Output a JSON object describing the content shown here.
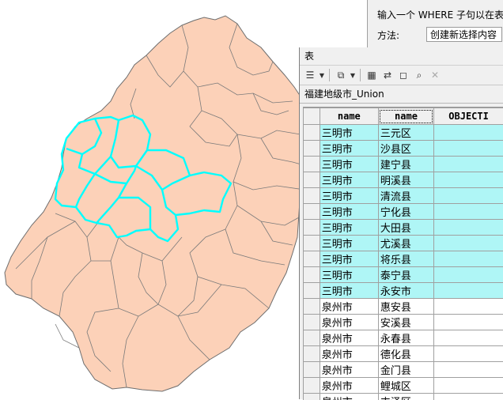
{
  "dialog": {
    "hint": "输入一个 WHERE 子句以在表",
    "method_label": "方法:",
    "method_value": "创建新选择内容"
  },
  "table_window": {
    "title": "表",
    "tab_name": "福建地级市_Union",
    "toolbar": [
      {
        "icon": "table-options-icon",
        "glyph": "☰"
      },
      {
        "icon": "related-tables-icon",
        "glyph": "⧉"
      },
      {
        "icon": "select-by-attributes-icon",
        "glyph": "▦"
      },
      {
        "icon": "switch-selection-icon",
        "glyph": "⇄"
      },
      {
        "icon": "clear-selection-icon",
        "glyph": "◻"
      },
      {
        "icon": "zoom-to-selected-icon",
        "glyph": "⌕"
      },
      {
        "icon": "delete-selected-icon",
        "glyph": "✕"
      }
    ],
    "columns": [
      "name",
      "name",
      "OBJECTI"
    ],
    "rows": [
      {
        "city": "三明市",
        "county": "三元区",
        "selected": true
      },
      {
        "city": "三明市",
        "county": "沙县区",
        "selected": true
      },
      {
        "city": "三明市",
        "county": "建宁县",
        "selected": true
      },
      {
        "city": "三明市",
        "county": "明溪县",
        "selected": true
      },
      {
        "city": "三明市",
        "county": "清流县",
        "selected": true
      },
      {
        "city": "三明市",
        "county": "宁化县",
        "selected": true
      },
      {
        "city": "三明市",
        "county": "大田县",
        "selected": true
      },
      {
        "city": "三明市",
        "county": "尤溪县",
        "selected": true
      },
      {
        "city": "三明市",
        "county": "将乐县",
        "selected": true
      },
      {
        "city": "三明市",
        "county": "泰宁县",
        "selected": true
      },
      {
        "city": "三明市",
        "county": "永安市",
        "selected": true
      },
      {
        "city": "泉州市",
        "county": "惠安县",
        "selected": false
      },
      {
        "city": "泉州市",
        "county": "安溪县",
        "selected": false
      },
      {
        "city": "泉州市",
        "county": "永春县",
        "selected": false
      },
      {
        "city": "泉州市",
        "county": "德化县",
        "selected": false
      },
      {
        "city": "泉州市",
        "county": "金门县",
        "selected": false
      },
      {
        "city": "泉州市",
        "county": "鲤城区",
        "selected": false
      },
      {
        "city": "泉州市",
        "county": "丰泽区",
        "selected": false
      }
    ]
  },
  "map": {
    "fill_color": "#fcd1b8",
    "border_color": "#6e6e6e",
    "highlight_color": "#00ffff"
  }
}
